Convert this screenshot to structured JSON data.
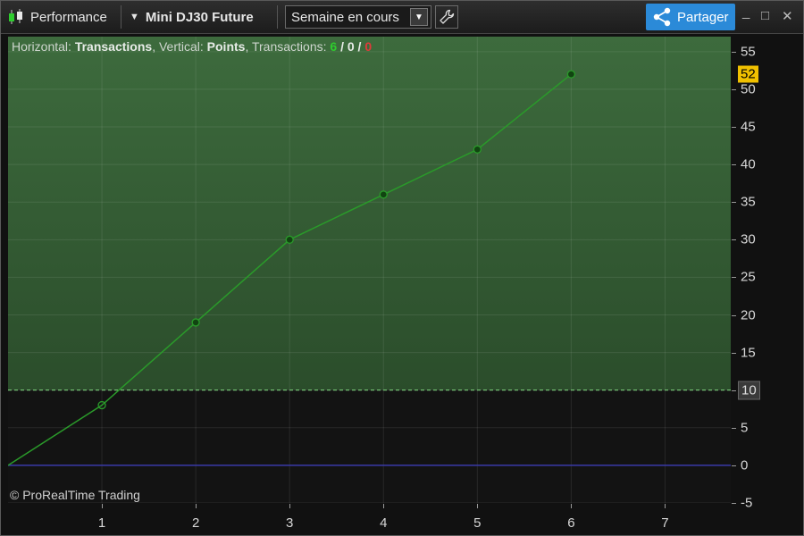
{
  "toolbar": {
    "title": "Performance",
    "instrument": "Mini DJ30 Future",
    "period": "Semaine en cours",
    "share_label": "Partager",
    "minimize": "_",
    "maximize": "□",
    "close": "✕"
  },
  "header": {
    "horizontal_label": "Horizontal:",
    "horizontal_value": "Transactions",
    "vertical_label": "Vertical:",
    "vertical_value": "Points",
    "transactions_label": "Transactions:",
    "winning": "6",
    "neutral": "0",
    "losing": "0",
    "slash": "/"
  },
  "copyright": "© ProRealTime Trading",
  "colors": {
    "accent": "#2b8ad8",
    "line": "#2a9a2a",
    "zero_line": "#3a3aa8",
    "threshold": "#7ad07a",
    "badge_last": "#f0c000"
  },
  "chart_data": {
    "type": "line",
    "x": [
      0,
      1,
      2,
      3,
      4,
      5,
      6
    ],
    "values": [
      0,
      8,
      19,
      30,
      36,
      42,
      52
    ],
    "xlim": [
      0,
      7.7
    ],
    "ylim": [
      -5,
      57
    ],
    "xticks": [
      "1",
      "2",
      "3",
      "4",
      "5",
      "6",
      "7"
    ],
    "yticks": [
      "55",
      "50",
      "45",
      "40",
      "35",
      "30",
      "25",
      "20",
      "15",
      "10",
      "5",
      "0",
      "-5"
    ],
    "threshold": 10,
    "threshold_label": "10",
    "last_value_label": "52",
    "grid": true
  }
}
